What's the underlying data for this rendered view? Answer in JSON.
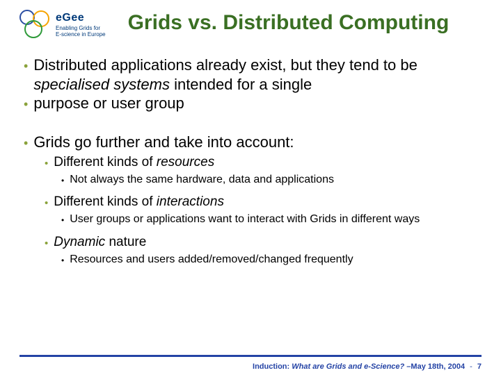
{
  "logo": {
    "brand": "eGee",
    "tagline_l1": "Enabling Grids for",
    "tagline_l2": "E-science in Europe"
  },
  "title": "Grids vs. Distributed Computing",
  "body": {
    "b1a": "Distributed applications already exist, but they tend to be ",
    "b1b_italic": "specialised systems",
    "b1c": " intended for a single",
    "b2": "purpose or user group",
    "b3": "Grids go further and take into account:",
    "b4a": "Different kinds of ",
    "b4b_italic": "resources",
    "b5": "Not always the same hardware, data and applications",
    "b6a": "Different kinds of ",
    "b6b_italic": "interactions",
    "b7": "User groups or applications want to interact with Grids in different ways",
    "b8a_italic": "Dynamic",
    "b8b": " nature",
    "b9": "Resources and users added/removed/changed frequently"
  },
  "footer": {
    "course_prefix": "Induction: ",
    "course_italic": "What are Grids and e-Science?",
    "date": " –May 18th, 2004",
    "sep": " - ",
    "page": "7"
  }
}
